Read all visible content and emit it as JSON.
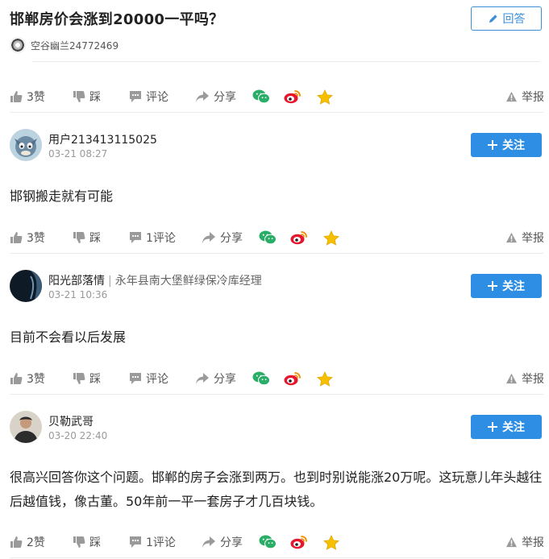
{
  "question": {
    "title": "邯郸房价会涨到20000一平吗？",
    "answer_label": "回答",
    "asker": "空谷幽兰24772469"
  },
  "question_actions": {
    "likes": "3赞",
    "dislike": "踩",
    "comment": "评论",
    "share": "分享",
    "report": "举报"
  },
  "follow_label": "关注",
  "answers": [
    {
      "username": "用户213413115025",
      "user_title": "",
      "time": "03-21 08:27",
      "content": "邯钢搬走就有可能",
      "likes": "3赞",
      "dislike": "踩",
      "comment": "1评论",
      "share": "分享",
      "report": "举报"
    },
    {
      "username": "阳光部落情",
      "user_title": "永年县南大堡鲜绿保冷库经理",
      "time": "03-21 10:36",
      "content": "目前不会看以后发展",
      "likes": "3赞",
      "dislike": "踩",
      "comment": "评论",
      "share": "分享",
      "report": "举报"
    },
    {
      "username": "贝勒武哥",
      "user_title": "",
      "time": "03-20 22:40",
      "content": "很高兴回答你这个问题。邯郸的房子会涨到两万。也到时别说能涨20万呢。这玩意儿年头越往后越值钱，像古董。50年前一平一套房子才几百块钱。",
      "likes": "2赞",
      "dislike": "踩",
      "comment": "1评论",
      "share": "分享",
      "report": "举报"
    }
  ],
  "colors": {
    "accent": "#2d8ee3",
    "wechat": "#2aae67",
    "weibo": "#e6162d",
    "star": "#f6c000"
  }
}
